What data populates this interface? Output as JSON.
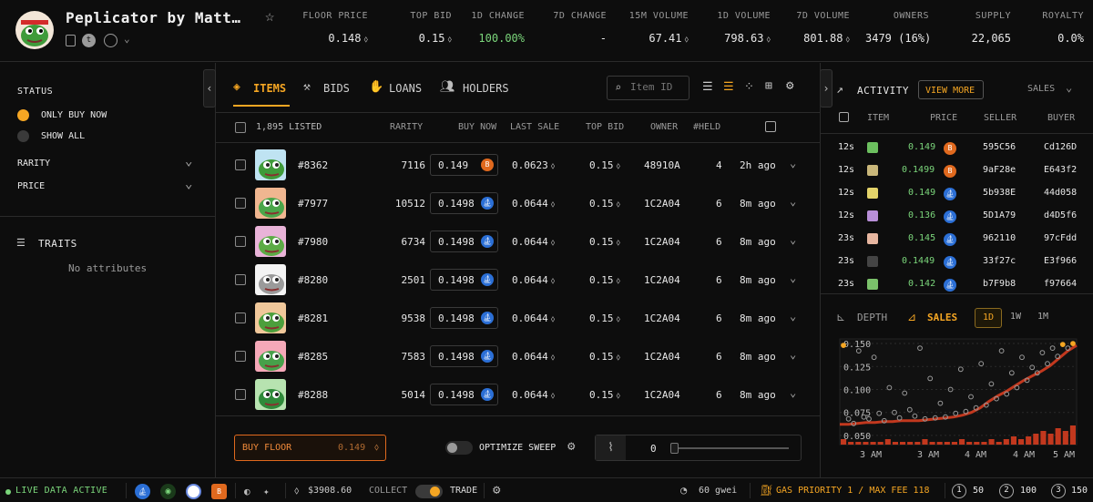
{
  "collection": {
    "name": "Peplicator by Matt…",
    "stats": [
      {
        "label": "FLOOR PRICE",
        "value": "0.148",
        "eth": true
      },
      {
        "label": "TOP BID",
        "value": "0.15",
        "eth": true
      },
      {
        "label": "1D CHANGE",
        "value": "100.00%",
        "eth": false,
        "color": "#7bd67b"
      },
      {
        "label": "7D CHANGE",
        "value": "-",
        "eth": false
      },
      {
        "label": "15M VOLUME",
        "value": "67.41",
        "eth": true
      },
      {
        "label": "1D VOLUME",
        "value": "798.63",
        "eth": true
      },
      {
        "label": "7D VOLUME",
        "value": "801.88",
        "eth": true
      },
      {
        "label": "OWNERS",
        "value": "3479 (16%)",
        "eth": false
      },
      {
        "label": "SUPPLY",
        "value": "22,065",
        "eth": false
      },
      {
        "label": "ROYALTY",
        "value": "0.0%",
        "eth": false
      }
    ]
  },
  "filters": {
    "status_title": "STATUS",
    "opt_buy_now": "ONLY BUY NOW",
    "opt_show_all": "SHOW ALL",
    "rarity": "RARITY",
    "price": "PRICE",
    "traits": "TRAITS",
    "no_attributes": "No attributes"
  },
  "tabs": {
    "items": "ITEMS",
    "bids": "BIDS",
    "loans": "LOANS",
    "holders": "HOLDERS",
    "search_placeholder": "Item ID"
  },
  "table": {
    "listed": "1,895 LISTED",
    "cols": {
      "rarity": "RARITY",
      "buy_now": "BUY NOW",
      "last_sale": "LAST SALE",
      "top_bid": "TOP BID",
      "owner": "OWNER",
      "held": "#HELD"
    },
    "rows": [
      {
        "id": "#8362",
        "rarity": "7116",
        "price": "0.149",
        "market": "blur",
        "last": "0.0623",
        "top": "0.15",
        "owner": "48910A",
        "held": "4",
        "ago": "2h ago",
        "bg": "#bfe3f2",
        "skin": "#3f9b3a"
      },
      {
        "id": "#7977",
        "rarity": "10512",
        "price": "0.1498",
        "market": "os",
        "last": "0.0644",
        "top": "0.15",
        "owner": "1C2A04",
        "held": "6",
        "ago": "8m ago",
        "bg": "#f0b690",
        "skin": "#4aa64a"
      },
      {
        "id": "#7980",
        "rarity": "6734",
        "price": "0.1498",
        "market": "os",
        "last": "0.0644",
        "top": "0.15",
        "owner": "1C2A04",
        "held": "6",
        "ago": "8m ago",
        "bg": "#e9b3d8",
        "skin": "#5cab45"
      },
      {
        "id": "#8280",
        "rarity": "2501",
        "price": "0.1498",
        "market": "os",
        "last": "0.0644",
        "top": "0.15",
        "owner": "1C2A04",
        "held": "6",
        "ago": "8m ago",
        "bg": "#f4f4f4",
        "skin": "#9a9a9a"
      },
      {
        "id": "#8281",
        "rarity": "9538",
        "price": "0.1498",
        "market": "os",
        "last": "0.0644",
        "top": "0.15",
        "owner": "1C2A04",
        "held": "6",
        "ago": "8m ago",
        "bg": "#f0c79a",
        "skin": "#4c9f3c"
      },
      {
        "id": "#8285",
        "rarity": "7583",
        "price": "0.1498",
        "market": "os",
        "last": "0.0644",
        "top": "0.15",
        "owner": "1C2A04",
        "held": "6",
        "ago": "8m ago",
        "bg": "#f5a8b8",
        "skin": "#47a04a"
      },
      {
        "id": "#8288",
        "rarity": "5014",
        "price": "0.1498",
        "market": "os",
        "last": "0.0644",
        "top": "0.15",
        "owner": "1C2A04",
        "held": "6",
        "ago": "8m ago",
        "bg": "#b7e3b0",
        "skin": "#2f8a3a"
      }
    ]
  },
  "sweep": {
    "buy_floor": "BUY FLOOR",
    "buy_floor_price": "0.149",
    "optimize": "OPTIMIZE SWEEP",
    "count": "0"
  },
  "activity": {
    "title": "ACTIVITY",
    "view_more": "VIEW MORE",
    "filter": "SALES",
    "cols": {
      "item": "ITEM",
      "price": "PRICE",
      "seller": "SELLER",
      "buyer": "BUYER"
    },
    "rows": [
      {
        "t": "12s",
        "price": "0.149",
        "m": "blur",
        "seller": "595C56",
        "buyer": "Cd126D",
        "chip": "#6cbf5f"
      },
      {
        "t": "12s",
        "price": "0.1499",
        "m": "blur",
        "seller": "9aF28e",
        "buyer": "E643f2",
        "chip": "#c9b77a"
      },
      {
        "t": "12s",
        "price": "0.149",
        "m": "os",
        "seller": "5b938E",
        "buyer": "44d058",
        "chip": "#e3d36a"
      },
      {
        "t": "12s",
        "price": "0.136",
        "m": "os",
        "seller": "5D1A79",
        "buyer": "d4D5f6",
        "chip": "#b88fd8"
      },
      {
        "t": "23s",
        "price": "0.145",
        "m": "os",
        "seller": "962110",
        "buyer": "97cFdd",
        "chip": "#e7b6a0"
      },
      {
        "t": "23s",
        "price": "0.1449",
        "m": "os",
        "seller": "33f27c",
        "buyer": "E3f966",
        "chip": "#444444"
      },
      {
        "t": "23s",
        "price": "0.142",
        "m": "os",
        "seller": "b7F9b8",
        "buyer": "f97664",
        "chip": "#7bc26b"
      }
    ]
  },
  "chart_tabs": {
    "depth": "DEPTH",
    "sales": "SALES",
    "ranges": [
      "1D",
      "1W",
      "1M"
    ]
  },
  "chart_data": {
    "type": "scatter",
    "title": "",
    "xlabel": "",
    "ylabel": "",
    "y_ticks": [
      "0.150",
      "0.125",
      "0.100",
      "0.075",
      "0.050"
    ],
    "x_ticks": [
      "3 AM",
      "3 AM",
      "4 AM",
      "4 AM",
      "5 AM"
    ],
    "ylim": [
      0.04,
      0.155
    ],
    "floor_line": [
      0.062,
      0.062,
      0.063,
      0.064,
      0.064,
      0.065,
      0.065,
      0.066,
      0.066,
      0.066,
      0.067,
      0.068,
      0.069,
      0.07,
      0.072,
      0.075,
      0.08,
      0.087,
      0.093,
      0.098,
      0.104,
      0.11,
      0.115,
      0.12,
      0.126,
      0.134,
      0.142,
      0.148
    ],
    "sales": [
      0.148,
      0.068,
      0.063,
      0.142,
      0.07,
      0.068,
      0.135,
      0.074,
      0.066,
      0.102,
      0.075,
      0.069,
      0.096,
      0.078,
      0.071,
      0.145,
      0.068,
      0.112,
      0.069,
      0.085,
      0.07,
      0.1,
      0.074,
      0.122,
      0.076,
      0.092,
      0.08,
      0.128,
      0.083,
      0.106,
      0.09,
      0.142,
      0.095,
      0.118,
      0.102,
      0.135,
      0.11,
      0.124,
      0.118,
      0.14,
      0.128,
      0.145,
      0.136,
      0.149,
      0.145,
      0.1499
    ],
    "volume": [
      2,
      1,
      1,
      1,
      1,
      1,
      2,
      1,
      1,
      1,
      1,
      2,
      1,
      1,
      1,
      1,
      2,
      1,
      1,
      1,
      2,
      1,
      2,
      3,
      2,
      3,
      4,
      5,
      4,
      6,
      5,
      7
    ]
  },
  "bottom": {
    "live": "LIVE DATA ACTIVE",
    "eth_price": "$3908.60",
    "collect": "COLLECT",
    "trade": "TRADE",
    "gas": "60 gwei",
    "gas_priority": "GAS PRIORITY 1 / MAX FEE 118",
    "q1": "50",
    "q2": "100",
    "q3": "150"
  },
  "colors": {
    "accent": "#f5a623",
    "green": "#7bd67b",
    "blue": "#2b6fd6",
    "orange": "#e0691e"
  }
}
